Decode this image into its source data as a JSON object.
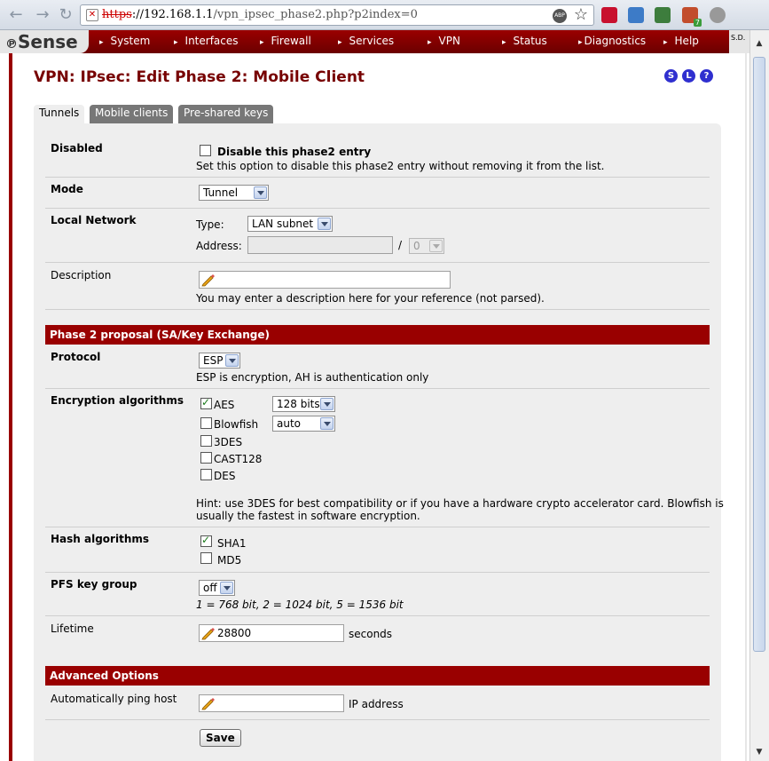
{
  "browser": {
    "url_scheme": "https",
    "url_host": "://192.168.1.1",
    "url_path": "/vpn_ipsec_phase2.php?p2index=0",
    "abp_label": "ABP",
    "badge_count": "7"
  },
  "menu": {
    "logo": "Sense",
    "items": [
      "System",
      "Interfaces",
      "Firewall",
      "Services",
      "VPN",
      "Status",
      "Diagnostics",
      "Help"
    ],
    "corner_text": "S.D."
  },
  "page": {
    "title": "VPN: IPsec: Edit Phase 2: Mobile Client",
    "help_icons": [
      "S",
      "L",
      "?"
    ]
  },
  "tabs": [
    "Tunnels",
    "Mobile clients",
    "Pre-shared keys"
  ],
  "form": {
    "disabled": {
      "label": "Disabled",
      "checkbox_label": "Disable this phase2 entry",
      "hint": "Set this option to disable this phase2 entry without removing it from the list.",
      "checked": false
    },
    "mode": {
      "label": "Mode",
      "value": "Tunnel"
    },
    "local_network": {
      "label": "Local Network",
      "type_label": "Type:",
      "type_value": "LAN subnet",
      "address_label": "Address:",
      "address_value": "",
      "separator": "/",
      "mask_value": "0"
    },
    "description": {
      "label": "Description",
      "value": "",
      "hint": "You may enter a description here for your reference (not parsed)."
    },
    "phase2_section": "Phase 2 proposal (SA/Key Exchange)",
    "protocol": {
      "label": "Protocol",
      "value": "ESP",
      "hint": "ESP is encryption, AH is authentication only"
    },
    "encryption": {
      "label": "Encryption algorithms",
      "algorithms": [
        {
          "name": "AES",
          "checked": true,
          "keylen": "128 bits"
        },
        {
          "name": "Blowfish",
          "checked": false,
          "keylen": "auto"
        },
        {
          "name": "3DES",
          "checked": false
        },
        {
          "name": "CAST128",
          "checked": false
        },
        {
          "name": "DES",
          "checked": false
        }
      ],
      "hint_line1": "Hint: use 3DES for best compatibility or if you have a hardware crypto accelerator card. Blowfish is",
      "hint_line2": "usually the fastest in software encryption."
    },
    "hash": {
      "label": "Hash algorithms",
      "algorithms": [
        {
          "name": "SHA1",
          "checked": true
        },
        {
          "name": "MD5",
          "checked": false
        }
      ]
    },
    "pfs": {
      "label": "PFS key group",
      "value": "off",
      "hint": "1 = 768 bit, 2 = 1024 bit, 5 = 1536 bit"
    },
    "lifetime": {
      "label": "Lifetime",
      "value": "28800",
      "unit": "seconds"
    },
    "advanced_section": "Advanced Options",
    "ping_host": {
      "label": "Automatically ping host",
      "value": "",
      "unit": "IP address"
    },
    "save_label": "Save"
  }
}
